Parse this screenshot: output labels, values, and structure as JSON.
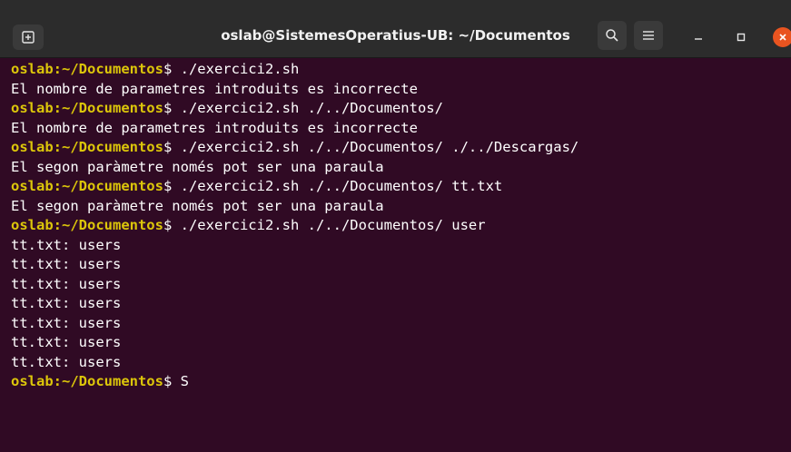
{
  "window": {
    "title": "oslab@SistemesOperatius-UB: ~/Documentos"
  },
  "icons": {
    "new_tab": "new-tab-icon",
    "search": "search-icon",
    "menu": "hamburger-menu-icon",
    "minimize": "minimize-icon",
    "maximize": "maximize-icon",
    "close": "close-icon"
  },
  "colors": {
    "terminal_bg": "#300a24",
    "prompt": "#dcc60a",
    "text": "#ffffff",
    "close_button": "#e95420"
  },
  "terminal": {
    "lines": [
      {
        "prompt": "oslab:~/Documentos",
        "text": "$ ./exercici2.sh"
      },
      {
        "text": "El nombre de parametres introduits es incorrecte"
      },
      {
        "prompt": "oslab:~/Documentos",
        "text": "$ ./exercici2.sh ./../Documentos/"
      },
      {
        "text": "El nombre de parametres introduits es incorrecte"
      },
      {
        "prompt": "oslab:~/Documentos",
        "text": "$ ./exercici2.sh ./../Documentos/ ./../Descargas/"
      },
      {
        "text": "El segon paràmetre només pot ser una paraula"
      },
      {
        "prompt": "oslab:~/Documentos",
        "text": "$ ./exercici2.sh ./../Documentos/ tt.txt"
      },
      {
        "text": "El segon paràmetre només pot ser una paraula"
      },
      {
        "prompt": "oslab:~/Documentos",
        "text": "$ ./exercici2.sh ./../Documentos/ user"
      },
      {
        "text": "tt.txt: users"
      },
      {
        "text": "tt.txt: users"
      },
      {
        "text": "tt.txt: users"
      },
      {
        "text": "tt.txt: users"
      },
      {
        "text": "tt.txt: users"
      },
      {
        "text": "tt.txt: users"
      },
      {
        "text": "tt.txt: users"
      },
      {
        "prompt": "oslab:~/Documentos",
        "text": "$ S"
      }
    ]
  }
}
